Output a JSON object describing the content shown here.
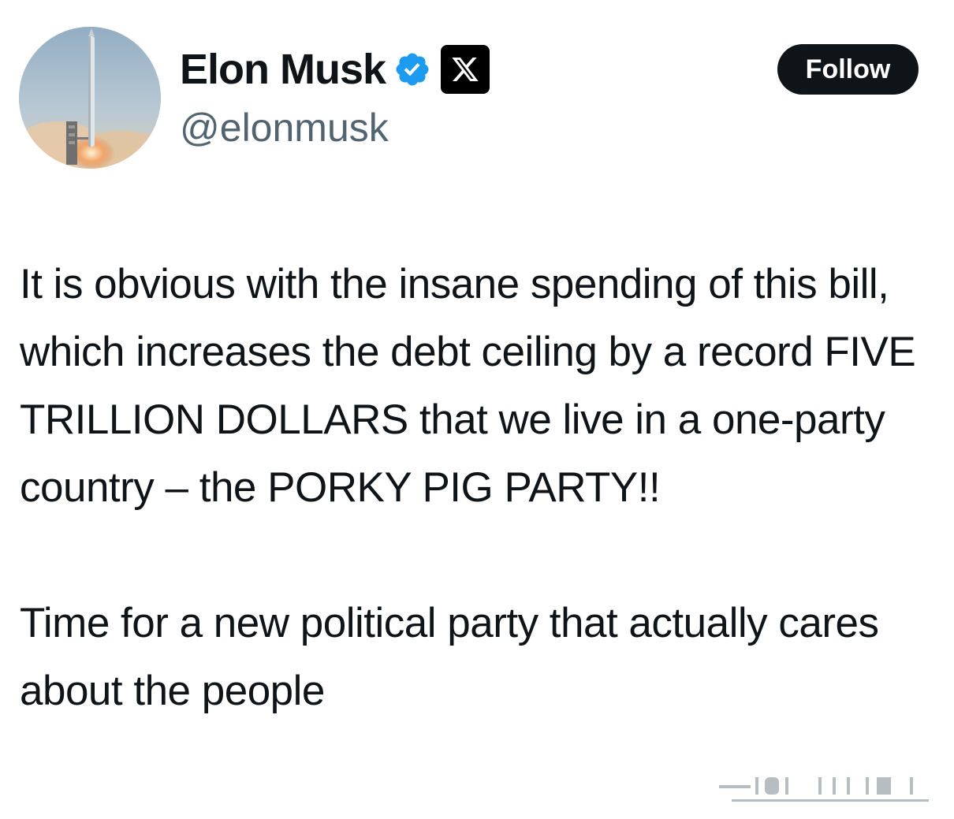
{
  "tweet": {
    "author": {
      "display_name": "Elon Musk",
      "handle": "@elonmusk",
      "avatar_icon": "rocket-launch-avatar",
      "verified_icon": "verified-badge-icon",
      "affiliation_icon": "x-logo-icon"
    },
    "follow_label": "Follow",
    "text": [
      "It is obvious with the insane spending of this bill, which increases the debt ceiling by a record FIVE TRILLION DOLLARS that we live in a one-party country – the PORKY PIG PARTY!!",
      "Time for a new political party that actually cares about the people"
    ]
  },
  "colors": {
    "text": "#0f1419",
    "secondary_text": "#536471",
    "verified": "#1d9bf0",
    "button_bg": "#0f1419",
    "button_text": "#ffffff"
  }
}
